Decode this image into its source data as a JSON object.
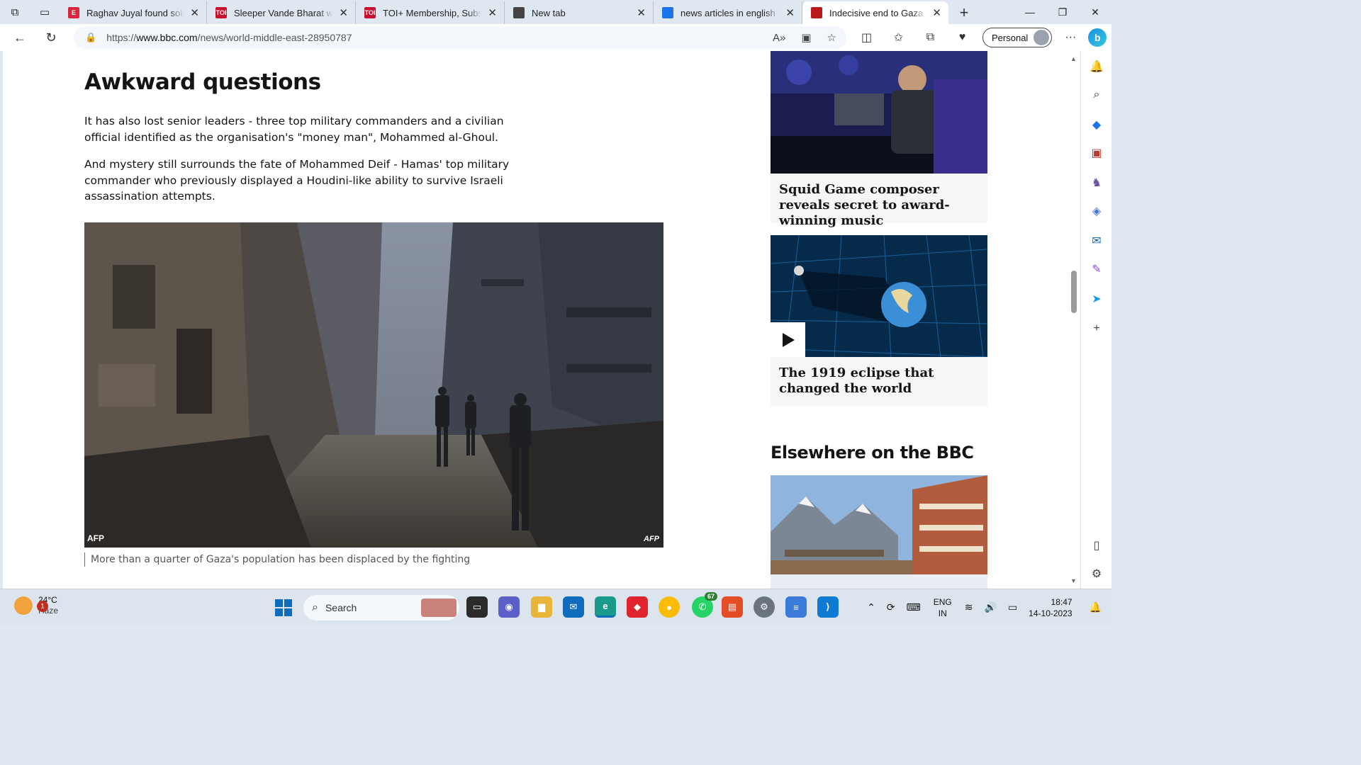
{
  "browser": {
    "tabs": [
      {
        "title": "Raghav Juyal found solace",
        "fav_text": "E",
        "fav_color": "#d7263d",
        "active": false
      },
      {
        "title": "Sleeper Vande Bharat will c",
        "fav_text": "TOI",
        "fav_color": "#c8102e",
        "active": false
      },
      {
        "title": "TOI+ Membership, Subscri",
        "fav_text": "TOI",
        "fav_color": "#c8102e",
        "active": false
      },
      {
        "title": "New tab",
        "fav_text": "",
        "fav_color": "#444444",
        "active": false
      },
      {
        "title": "news articles in english - S",
        "fav_text": "",
        "fav_color": "#1a73e8",
        "active": false
      },
      {
        "title": "Indecisive end to Gaza con",
        "fav_text": "",
        "fav_color": "#bb1919",
        "active": true
      }
    ],
    "url_prefix": "https://",
    "url_host": "www.bbc.com",
    "url_path": "/news/world-middle-east-28950787",
    "profile_label": "Personal"
  },
  "article": {
    "heading": "Awkward questions",
    "paragraph1": "It has also lost senior leaders - three top military commanders and a civilian official identified as the organisation's \"money man\", Mohammed al-Ghoul.",
    "paragraph2": "And mystery still surrounds the fate of Mohammed Deif - Hamas' top military commander who previously displayed a Houdini-like ability to survive Israeli assassination attempts.",
    "image_credit": "AFP",
    "image_watermark": "AFP",
    "caption": "More than a quarter of Gaza's population has been displaced by the fighting"
  },
  "sidebar": {
    "card1_title": "Squid Game composer reveals secret to award-winning music",
    "card2_title": "The 1919 eclipse that changed the world",
    "elsewhere_heading": "Elsewhere on the BBC"
  },
  "taskbar": {
    "weather_temp": "24°C",
    "weather_desc": "Haze",
    "weather_badge": "1",
    "search_label": "Search",
    "whatsapp_count": "67",
    "lang_line1": "ENG",
    "lang_line2": "IN",
    "time": "18:47",
    "date": "14-10-2023"
  },
  "colors": {
    "accent": "#0f6cbd",
    "bbc_red": "#bb1919",
    "window_bg": "#dfe7f1"
  }
}
